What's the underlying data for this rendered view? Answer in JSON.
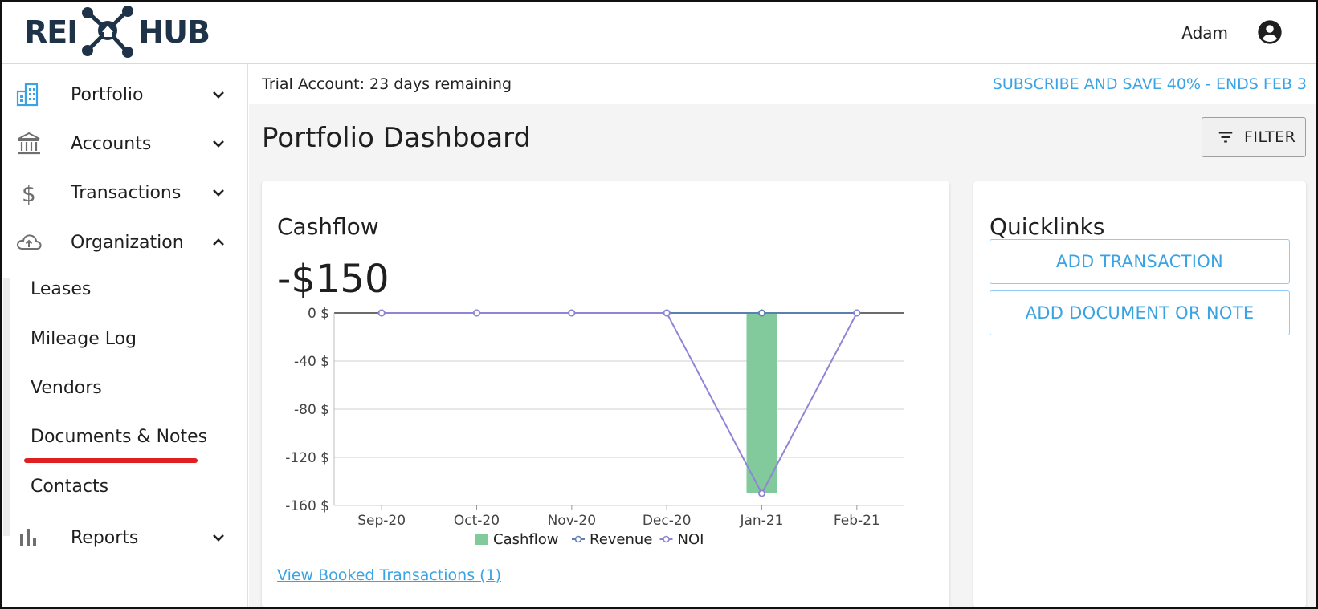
{
  "header": {
    "logo_left": "REI",
    "logo_right": "HUB",
    "user_name": "Adam",
    "account_icon": "account-circle-icon"
  },
  "sidebar": {
    "items": [
      {
        "label": "Portfolio",
        "icon": "building-icon",
        "expanded": false
      },
      {
        "label": "Accounts",
        "icon": "bank-icon",
        "expanded": false
      },
      {
        "label": "Transactions",
        "icon": "dollar-icon",
        "expanded": false
      },
      {
        "label": "Organization",
        "icon": "cloud-upload-icon",
        "expanded": true
      },
      {
        "label": "Reports",
        "icon": "bar-chart-icon",
        "expanded": false
      }
    ],
    "organization_children": [
      "Leases",
      "Mileage Log",
      "Vendors",
      "Documents & Notes",
      "Contacts"
    ],
    "highlighted_child": "Documents & Notes"
  },
  "main": {
    "trial_text": "Trial Account: 23 days remaining",
    "subscribe_link": "SUBSCRIBE AND SAVE 40% - ENDS FEB 3",
    "page_title": "Portfolio Dashboard",
    "filter_label": "FILTER"
  },
  "cashflow_card": {
    "title": "Cashflow",
    "value": "-$150",
    "view_link": "View Booked Transactions (1)"
  },
  "quicklinks": {
    "title": "Quicklinks",
    "buttons": [
      "ADD TRANSACTION",
      "ADD DOCUMENT OR NOTE"
    ]
  },
  "colors": {
    "accent": "#3aa3e3",
    "logo_navy": "#1f3348",
    "cashflow_bar": "#82c99b",
    "revenue_line": "#5b7fb0",
    "noi_line": "#8e85d6",
    "annotation_underline": "#e02020"
  },
  "chart_data": {
    "type": "bar",
    "categories": [
      "Sep-20",
      "Oct-20",
      "Nov-20",
      "Dec-20",
      "Jan-21",
      "Feb-21"
    ],
    "series": [
      {
        "name": "Cashflow",
        "kind": "bar",
        "values": [
          0,
          0,
          0,
          0,
          -150,
          0
        ]
      },
      {
        "name": "Revenue",
        "kind": "line",
        "values": [
          0,
          0,
          0,
          0,
          0,
          0
        ]
      },
      {
        "name": "NOI",
        "kind": "line",
        "values": [
          0,
          0,
          0,
          0,
          -150,
          0
        ]
      }
    ],
    "y_ticks": [
      "0 $",
      "-40 $",
      "-80 $",
      "-120 $",
      "-160 $"
    ],
    "y_tick_values": [
      0,
      -40,
      -80,
      -120,
      -160
    ],
    "ylim": [
      -160,
      0
    ],
    "grid": true,
    "legend_position": "bottom"
  }
}
